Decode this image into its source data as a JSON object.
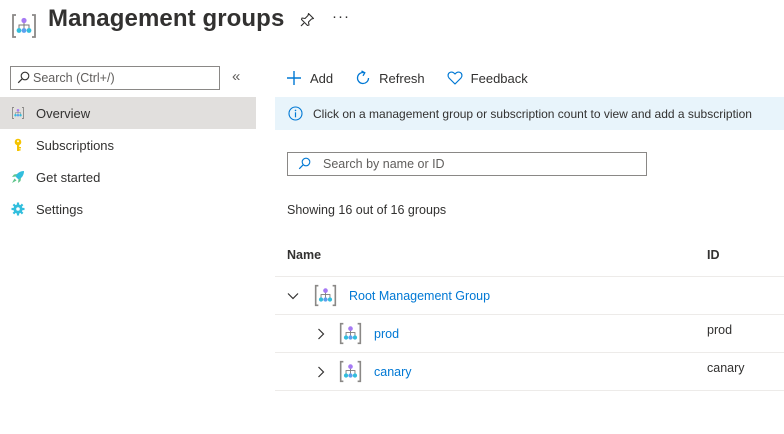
{
  "header": {
    "title": "Management groups",
    "icon": "management-group-icon",
    "pin_icon": "pin-icon",
    "more_label": "···"
  },
  "sidebar": {
    "search_placeholder": "Search (Ctrl+/)",
    "collapse_label": "«",
    "items": [
      {
        "label": "Overview",
        "icon": "management-group-icon",
        "active": true
      },
      {
        "label": "Subscriptions",
        "icon": "key-icon",
        "active": false
      },
      {
        "label": "Get started",
        "icon": "rocket-icon",
        "active": false
      },
      {
        "label": "Settings",
        "icon": "gear-icon",
        "active": false
      }
    ]
  },
  "toolbar": {
    "add_label": "Add",
    "refresh_label": "Refresh",
    "feedback_label": "Feedback"
  },
  "info_banner": {
    "text": "Click on a management group or subscription count to view and add a subscription"
  },
  "group_search": {
    "placeholder": "Search by name or ID"
  },
  "count_text": "Showing 16 out of 16 groups",
  "table": {
    "columns": [
      "Name",
      "ID"
    ],
    "rows": [
      {
        "name": "Root Management Group",
        "id": "",
        "expanded": true,
        "level": 0
      },
      {
        "name": "prod",
        "id": "prod",
        "expanded": false,
        "level": 1
      },
      {
        "name": "canary",
        "id": "canary",
        "expanded": false,
        "level": 1
      }
    ]
  },
  "colors": {
    "accent": "#0078d4",
    "active_nav": "#e1dfdd",
    "banner": "#e8f4fb",
    "text": "#323130"
  }
}
